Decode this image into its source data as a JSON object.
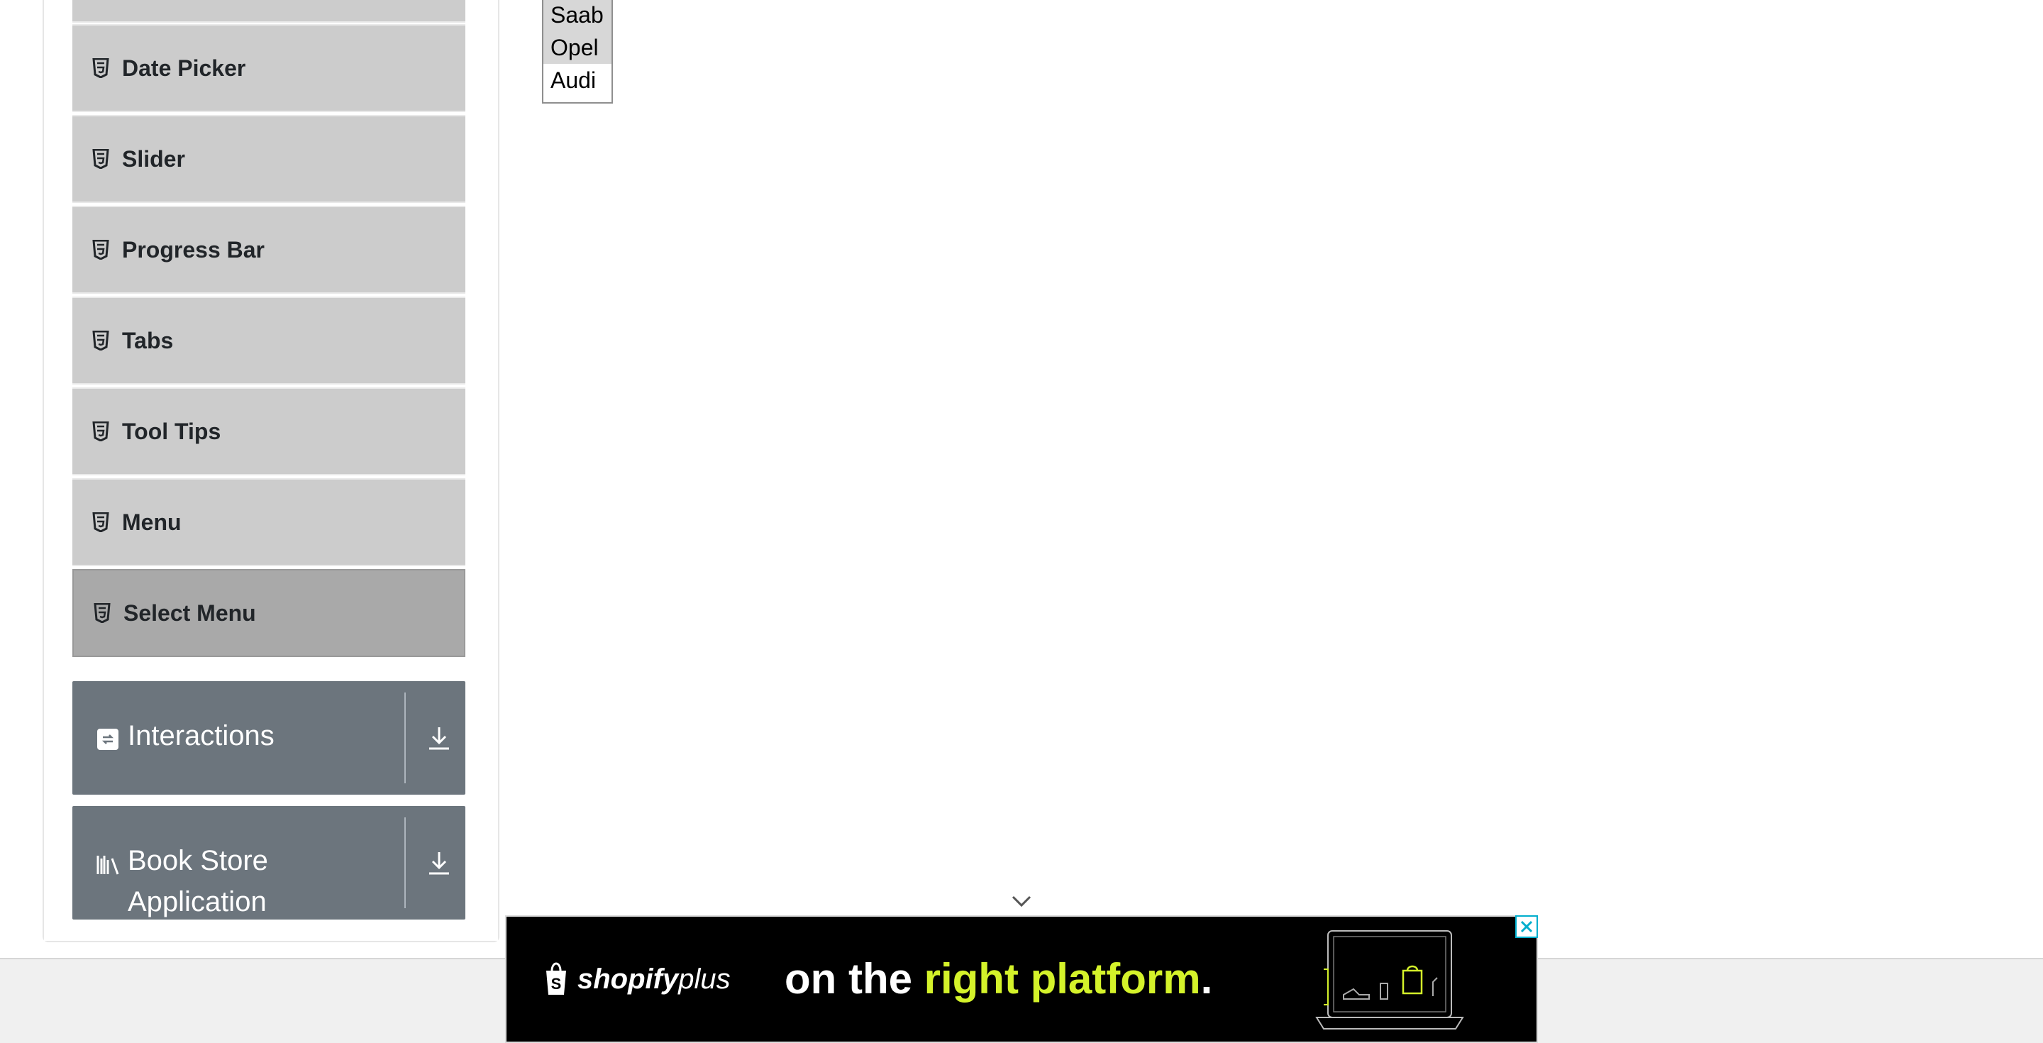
{
  "sidebar": {
    "widgets_items": [
      {
        "label": ""
      },
      {
        "label": "Date Picker"
      },
      {
        "label": "Slider"
      },
      {
        "label": "Progress Bar"
      },
      {
        "label": "Tabs"
      },
      {
        "label": "Tool Tips"
      },
      {
        "label": "Menu"
      },
      {
        "label": "Select Menu",
        "active": true
      }
    ],
    "groups": [
      {
        "label": "Interactions",
        "icon": "interactions-icon"
      },
      {
        "label_line1": "Book Store",
        "label_line2": "Application",
        "icon": "book-store-icon"
      }
    ]
  },
  "listbox": {
    "options": [
      "Saab",
      "Opel",
      "Audi"
    ],
    "selected": [
      "Saab",
      "Opel"
    ]
  },
  "ad": {
    "brand": "shopify",
    "brand_suffix": "plus",
    "tagline_start": "on the ",
    "tagline_highlight": "right platform",
    "tagline_end": ".",
    "highlight_color": "#d4f22a"
  },
  "colors": {
    "menu_bg": "#cccccc",
    "menu_active_bg": "#a9a9a9",
    "group_bg": "#6c757d"
  }
}
